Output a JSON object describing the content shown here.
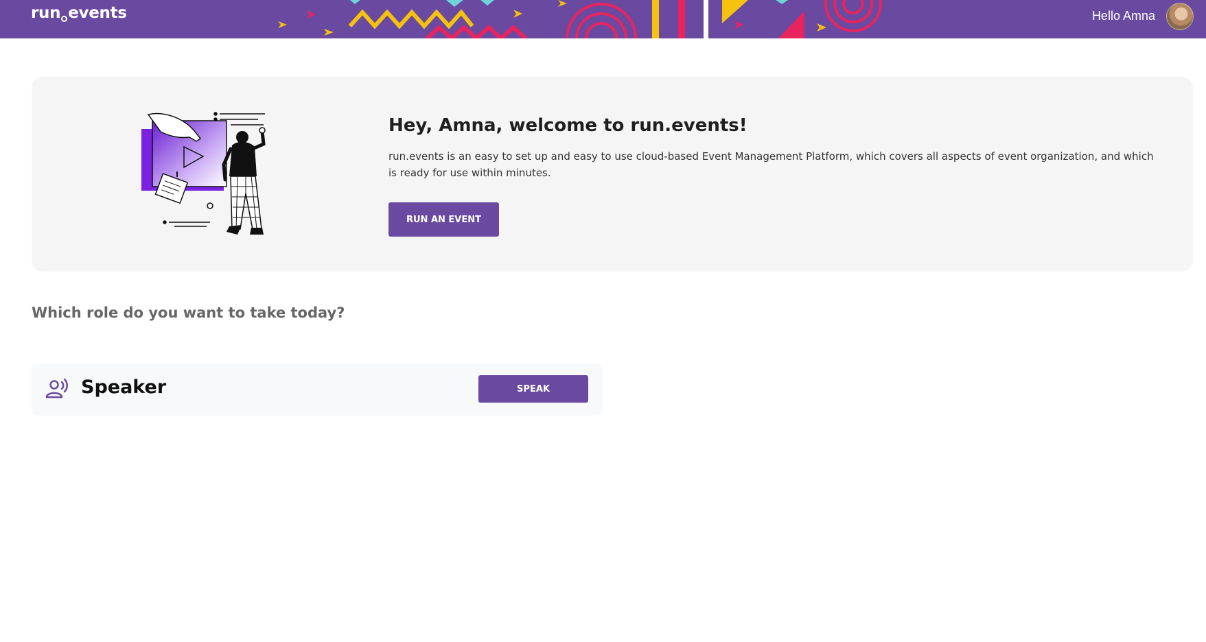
{
  "header": {
    "logo_part1": "run",
    "logo_part2": "events",
    "greeting": "Hello Amna",
    "colors": {
      "background": "#6a4aa0",
      "yellow": "#f5c20f",
      "pink": "#e8245f",
      "cyan": "#6fd3d8"
    }
  },
  "welcome": {
    "title": "Hey, Amna, welcome to run.events!",
    "description": "run.events is an easy to set up and easy to use cloud-based Event Management Platform, which covers all aspects of event organization, and which is ready for use within minutes.",
    "cta_label": "RUN AN EVENT"
  },
  "roles": {
    "question": "Which role do you want to take today?",
    "items": [
      {
        "title": "Speaker",
        "button_label": "SPEAK",
        "icon": "speaker-icon"
      }
    ]
  },
  "theme": {
    "accent": "#6a4aa0"
  }
}
